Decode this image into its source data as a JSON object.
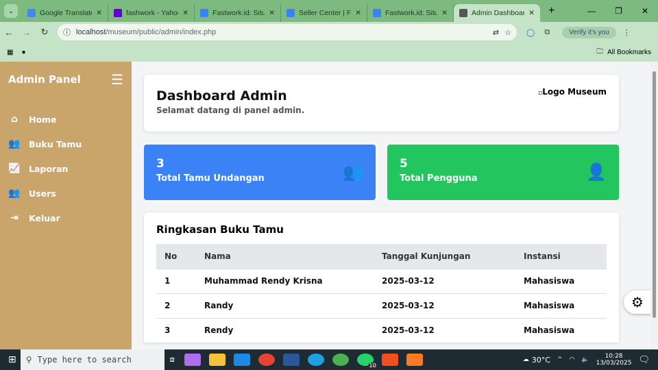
{
  "browser": {
    "tabs": [
      {
        "title": "Google Translate",
        "color": "#4285f4"
      },
      {
        "title": "fashwork - Yahoo S",
        "color": "#6001d2"
      },
      {
        "title": "Fastwork.id: Situs F",
        "color": "#3b82f6"
      },
      {
        "title": "Seller Center | Fast",
        "color": "#3b82f6"
      },
      {
        "title": "Fastwork.id: Situs F",
        "color": "#3b82f6"
      },
      {
        "title": "Admin Dashboard",
        "color": "#555"
      }
    ],
    "url_host": "localhost",
    "url_path": "/museum/public/admin/index.php",
    "verify": "Verify it's you",
    "bookmarks": "All Bookmarks"
  },
  "sidebar": {
    "title": "Admin Panel",
    "items": [
      {
        "label": "Home",
        "icon": "home-icon"
      },
      {
        "label": "Buku Tamu",
        "icon": "users-icon"
      },
      {
        "label": "Laporan",
        "icon": "chart-line-icon"
      },
      {
        "label": "Users",
        "icon": "users-icon"
      },
      {
        "label": "Keluar",
        "icon": "sign-out-icon"
      }
    ]
  },
  "header": {
    "title": "Dashboard Admin",
    "subtitle": "Selamat datang di panel admin.",
    "logo_alt": "Logo Museum"
  },
  "stats": [
    {
      "value": "3",
      "label": "Total Tamu Undangan",
      "color": "#3b82f6"
    },
    {
      "value": "5",
      "label": "Total Pengguna",
      "color": "#22c55e"
    }
  ],
  "summary": {
    "title": "Ringkasan Buku Tamu",
    "columns": [
      "No",
      "Nama",
      "Tanggal Kunjungan",
      "Instansi"
    ],
    "rows": [
      [
        "1",
        "Muhammad Rendy Krisna",
        "2025-03-12",
        "Mahasiswa"
      ],
      [
        "2",
        "Randy",
        "2025-03-12",
        "Mahasiswa"
      ],
      [
        "3",
        "Rendy",
        "2025-03-12",
        "Mahasiswa"
      ]
    ]
  },
  "taskbar": {
    "search": "Type here to search",
    "weather": "30°C",
    "time": "10:28",
    "date": "13/03/2025",
    "badge": "10"
  }
}
